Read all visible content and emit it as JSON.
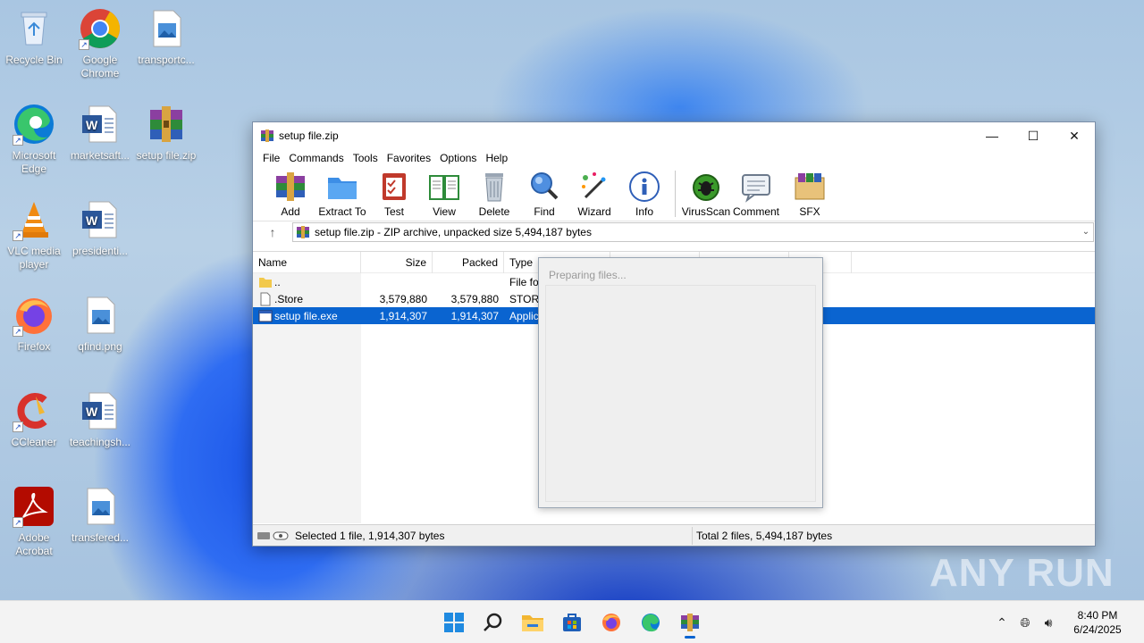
{
  "desktop": {
    "icons": [
      {
        "label": "Recycle Bin",
        "icon": "recycle-bin-icon"
      },
      {
        "label": "Google Chrome",
        "icon": "chrome-icon"
      },
      {
        "label": "transportc...",
        "icon": "image-file-icon"
      },
      {
        "label": "Microsoft Edge",
        "icon": "edge-icon"
      },
      {
        "label": "marketsaft...",
        "icon": "word-doc-icon"
      },
      {
        "label": "setup file.zip",
        "icon": "winrar-archive-icon"
      },
      {
        "label": "VLC media player",
        "icon": "vlc-icon"
      },
      {
        "label": "presidenti...",
        "icon": "word-doc-icon"
      },
      {
        "label": "Firefox",
        "icon": "firefox-icon"
      },
      {
        "label": "qfind.png",
        "icon": "image-file-icon"
      },
      {
        "label": "CCleaner",
        "icon": "ccleaner-icon"
      },
      {
        "label": "teachingsh...",
        "icon": "word-doc-icon"
      },
      {
        "label": "Adobe Acrobat",
        "icon": "acrobat-icon"
      },
      {
        "label": "transfered...",
        "icon": "image-file-icon"
      }
    ]
  },
  "window": {
    "title": "setup file.zip",
    "menu": [
      "File",
      "Commands",
      "Tools",
      "Favorites",
      "Options",
      "Help"
    ],
    "toolbar": [
      "Add",
      "Extract To",
      "Test",
      "View",
      "Delete",
      "Find",
      "Wizard",
      "Info",
      "VirusScan",
      "Comment",
      "SFX"
    ],
    "address": "setup file.zip - ZIP archive, unpacked size 5,494,187 bytes",
    "columns": {
      "name": "Name",
      "size": "Size",
      "packed": "Packed",
      "type": "Type"
    },
    "rows": [
      {
        "name": "..",
        "size": "",
        "packed": "",
        "type": "File fo"
      },
      {
        "name": ".Store",
        "size": "3,579,880",
        "packed": "3,579,880",
        "type": "STORE"
      },
      {
        "name": "setup file.exe",
        "size": "1,914,307",
        "packed": "1,914,307",
        "type": "Applic"
      }
    ],
    "status_left": "Selected 1 file, 1,914,307 bytes",
    "status_right": "Total 2 files, 5,494,187 bytes"
  },
  "dialog": {
    "text": "Preparing files..."
  },
  "watermark": "ANY RUN",
  "taskbar": {
    "apps": [
      "start-icon",
      "search-icon",
      "file-explorer-icon",
      "store-icon",
      "firefox-icon",
      "edge-icon",
      "winrar-icon"
    ],
    "time": "8:40 PM",
    "date": "6/24/2025"
  },
  "colors": {
    "selection": "#0a64d0",
    "accent": "#0a64d0"
  }
}
